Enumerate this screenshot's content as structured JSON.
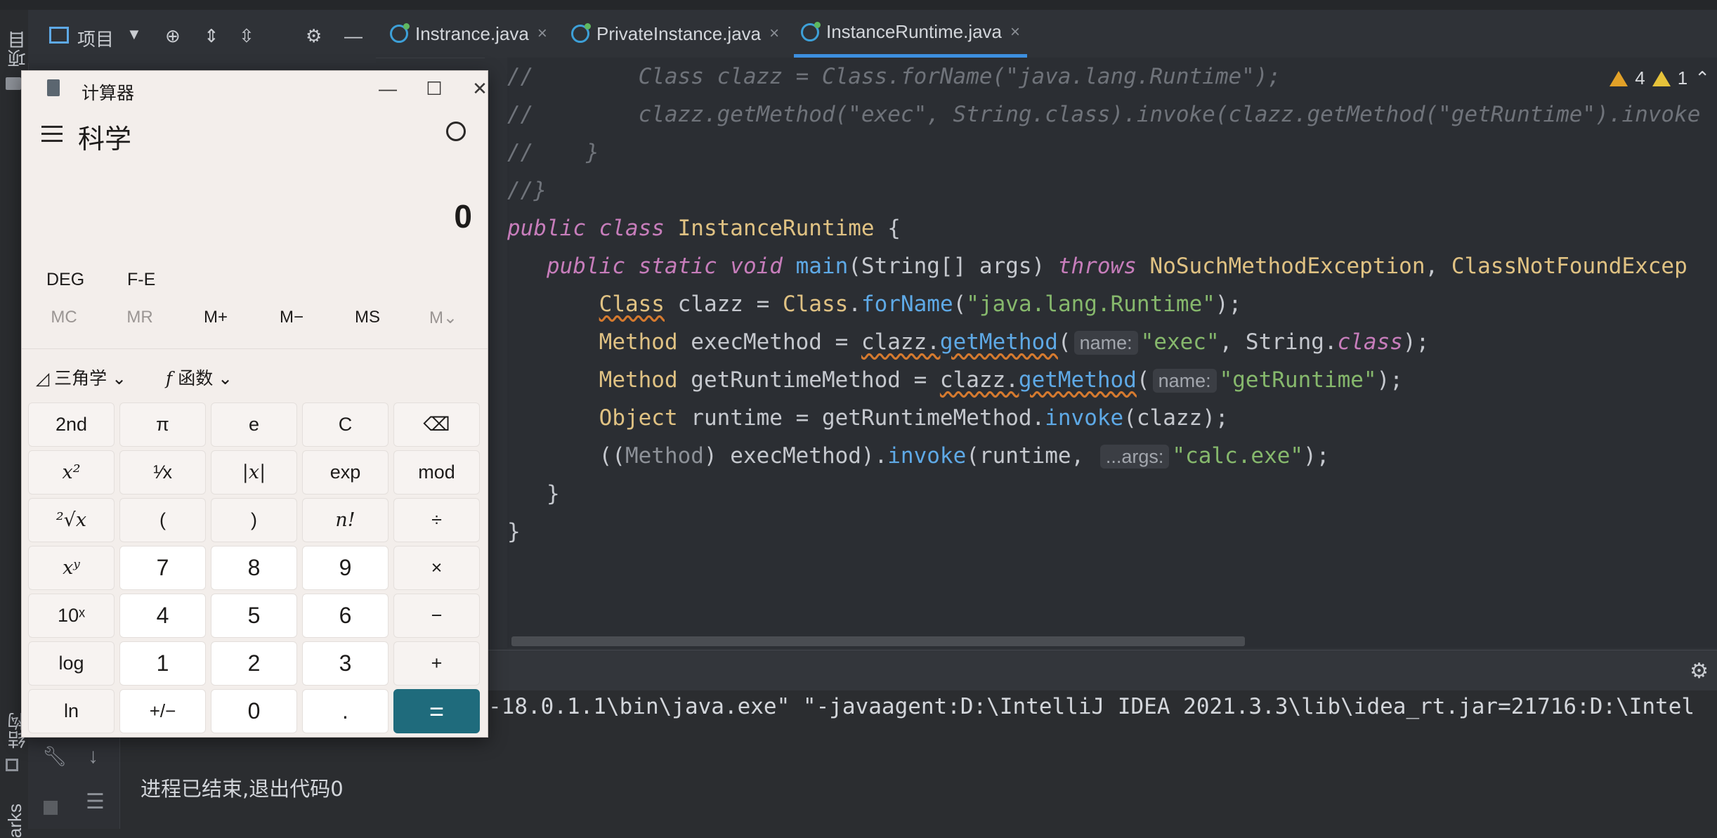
{
  "ide": {
    "left_labels": {
      "project": "项目",
      "structure": "结构",
      "bookmarks": "arks"
    },
    "toolbar": {
      "project_label": "项目"
    },
    "tabs": [
      {
        "label": "Instrance.java",
        "close": "×"
      },
      {
        "label": "PrivateInstance.java",
        "close": "×"
      },
      {
        "label": "InstanceRuntime.java",
        "close": "×"
      }
    ],
    "warnings": {
      "count_warn": "4",
      "count_weak": "1"
    },
    "code": {
      "l1": "//        Class clazz = Class.forName(\"java.lang.Runtime\");",
      "l2": "//        clazz.getMethod(\"exec\", String.class).invoke(clazz.getMethod(\"getRuntime\").invoke",
      "l3": "//    }",
      "l4": "//}",
      "hint_name": "name:",
      "hint_args": "...args:"
    },
    "console": {
      "cmd": "-18.0.1.1\\bin\\java.exe\" \"-javaagent:D:\\IntelliJ IDEA 2021.3.3\\lib\\idea_rt.jar=21716:D:\\Intel",
      "exit": "进程已结束,退出代码0"
    }
  },
  "calculator": {
    "title": "计算器",
    "mode": "科学",
    "display": "0",
    "options": {
      "deg": "DEG",
      "fe": "F-E"
    },
    "memory": [
      "MC",
      "MR",
      "M+",
      "M−",
      "MS",
      "M⌄"
    ],
    "dropdowns": {
      "trig": "三角学",
      "func": "函数"
    },
    "keys": {
      "r1": [
        "2nd",
        "π",
        "e",
        "C",
        "⌫"
      ],
      "r2": [
        "x²",
        "¹⁄x",
        "|x|",
        "exp",
        "mod"
      ],
      "r3": [
        "²√x",
        "(",
        ")",
        "n!",
        "÷"
      ],
      "r4": [
        "xʸ",
        "7",
        "8",
        "9",
        "×"
      ],
      "r5": [
        "10ˣ",
        "4",
        "5",
        "6",
        "−"
      ],
      "r6": [
        "log",
        "1",
        "2",
        "3",
        "+"
      ],
      "r7": [
        "ln",
        "+/−",
        "0",
        ".",
        "="
      ]
    }
  }
}
